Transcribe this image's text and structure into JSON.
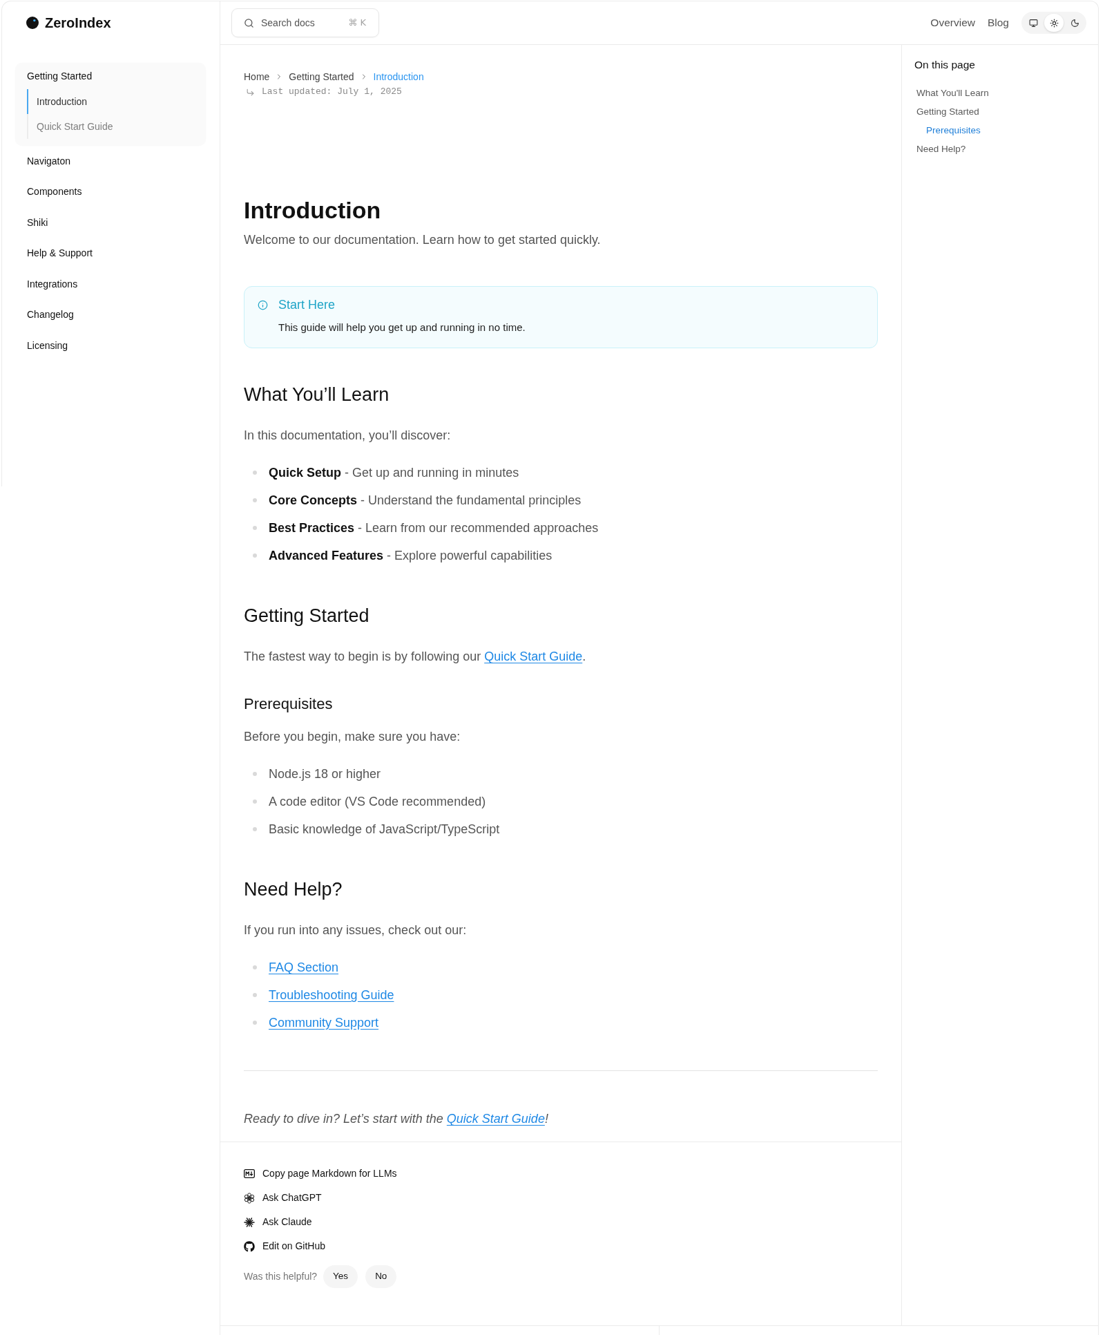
{
  "brand": {
    "name": "ZeroIndex"
  },
  "search": {
    "placeholder": "Search docs",
    "shortcut": "⌘ K"
  },
  "top_nav": [
    {
      "label": "Overview"
    },
    {
      "label": "Blog"
    }
  ],
  "theme_switch": [
    {
      "kind": "system",
      "selected": false
    },
    {
      "kind": "light",
      "selected": true
    },
    {
      "kind": "dark",
      "selected": false
    }
  ],
  "sidebar": {
    "items": [
      {
        "label": "Getting Started",
        "expanded": true,
        "children": [
          {
            "label": "Introduction",
            "selected": true
          },
          {
            "label": "Quick Start Guide",
            "selected": false
          }
        ]
      },
      {
        "label": "Navigaton",
        "expanded": false
      },
      {
        "label": "Components",
        "expanded": false
      },
      {
        "label": "Shiki",
        "expanded": false
      },
      {
        "label": "Help & Support",
        "expanded": false
      },
      {
        "label": "Integrations",
        "expanded": false
      },
      {
        "label": "Changelog",
        "expanded": false
      },
      {
        "label": "Licensing",
        "expanded": false
      }
    ]
  },
  "breadcrumb": [
    {
      "label": "Home",
      "current": false
    },
    {
      "label": "Getting Started",
      "current": false
    },
    {
      "label": "Introduction",
      "current": true
    }
  ],
  "last_updated": "Last updated: July 1, 2025",
  "article": {
    "title": "Introduction",
    "subtitle": "Welcome to our documentation. Learn how to get started quickly.",
    "callout": {
      "kind": "info",
      "title": "Start Here",
      "body": "This guide will help you get up and running in no time."
    },
    "blocks": [
      {
        "kind": "h2",
        "text": "What You’ll Learn"
      },
      {
        "kind": "paragraph",
        "text": "In this documentation, you’ll discover:"
      },
      {
        "kind": "list",
        "items": [
          "**Quick Setup** - Get up and running in minutes",
          "**Core Concepts** - Understand the fundamental principles",
          "**Best Practices** - Learn from our recommended approaches",
          "**Advanced Features** - Explore powerful capabilities"
        ]
      },
      {
        "kind": "h2",
        "text": "Getting Started"
      },
      {
        "kind": "paragraph",
        "text": "The fastest way to begin is by following our ",
        "link": "Quick Start Guide",
        "after": "."
      },
      {
        "kind": "h3",
        "text": "Prerequisites"
      },
      {
        "kind": "paragraph",
        "text": "Before you begin, make sure you have:"
      },
      {
        "kind": "list",
        "items": [
          "Node.js 18 or higher",
          "A code editor (VS Code recommended)",
          "Basic knowledge of JavaScript/TypeScript"
        ]
      },
      {
        "kind": "h2",
        "text": "Need Help?"
      },
      {
        "kind": "paragraph",
        "text": "If you run into any issues, check out our:"
      },
      {
        "kind": "link_list",
        "items": [
          "FAQ Section",
          "Troubleshooting Guide",
          "Community Support"
        ]
      },
      {
        "kind": "divider"
      },
      {
        "kind": "closing",
        "text": "Ready to dive in? Let’s start with the ",
        "link": "Quick Start Guide",
        "after": "!"
      }
    ]
  },
  "page_actions": [
    {
      "kind": "markdown",
      "label": "Copy page Markdown for LLMs"
    },
    {
      "kind": "chatgpt",
      "label": "Ask ChatGPT"
    },
    {
      "kind": "claude",
      "label": "Ask Claude"
    },
    {
      "kind": "github",
      "label": "Edit on GitHub"
    }
  ],
  "feedback": {
    "question": "Was this helpful?",
    "options": [
      "Yes",
      "No"
    ]
  },
  "toc": {
    "title": "On this page",
    "items": [
      {
        "label": "What You'll Learn",
        "selected": false
      },
      {
        "label": "Getting Started",
        "selected": false,
        "children": [
          {
            "label": "Prerequisites",
            "selected": true
          }
        ]
      },
      {
        "label": "Need Help?",
        "selected": false
      }
    ]
  }
}
